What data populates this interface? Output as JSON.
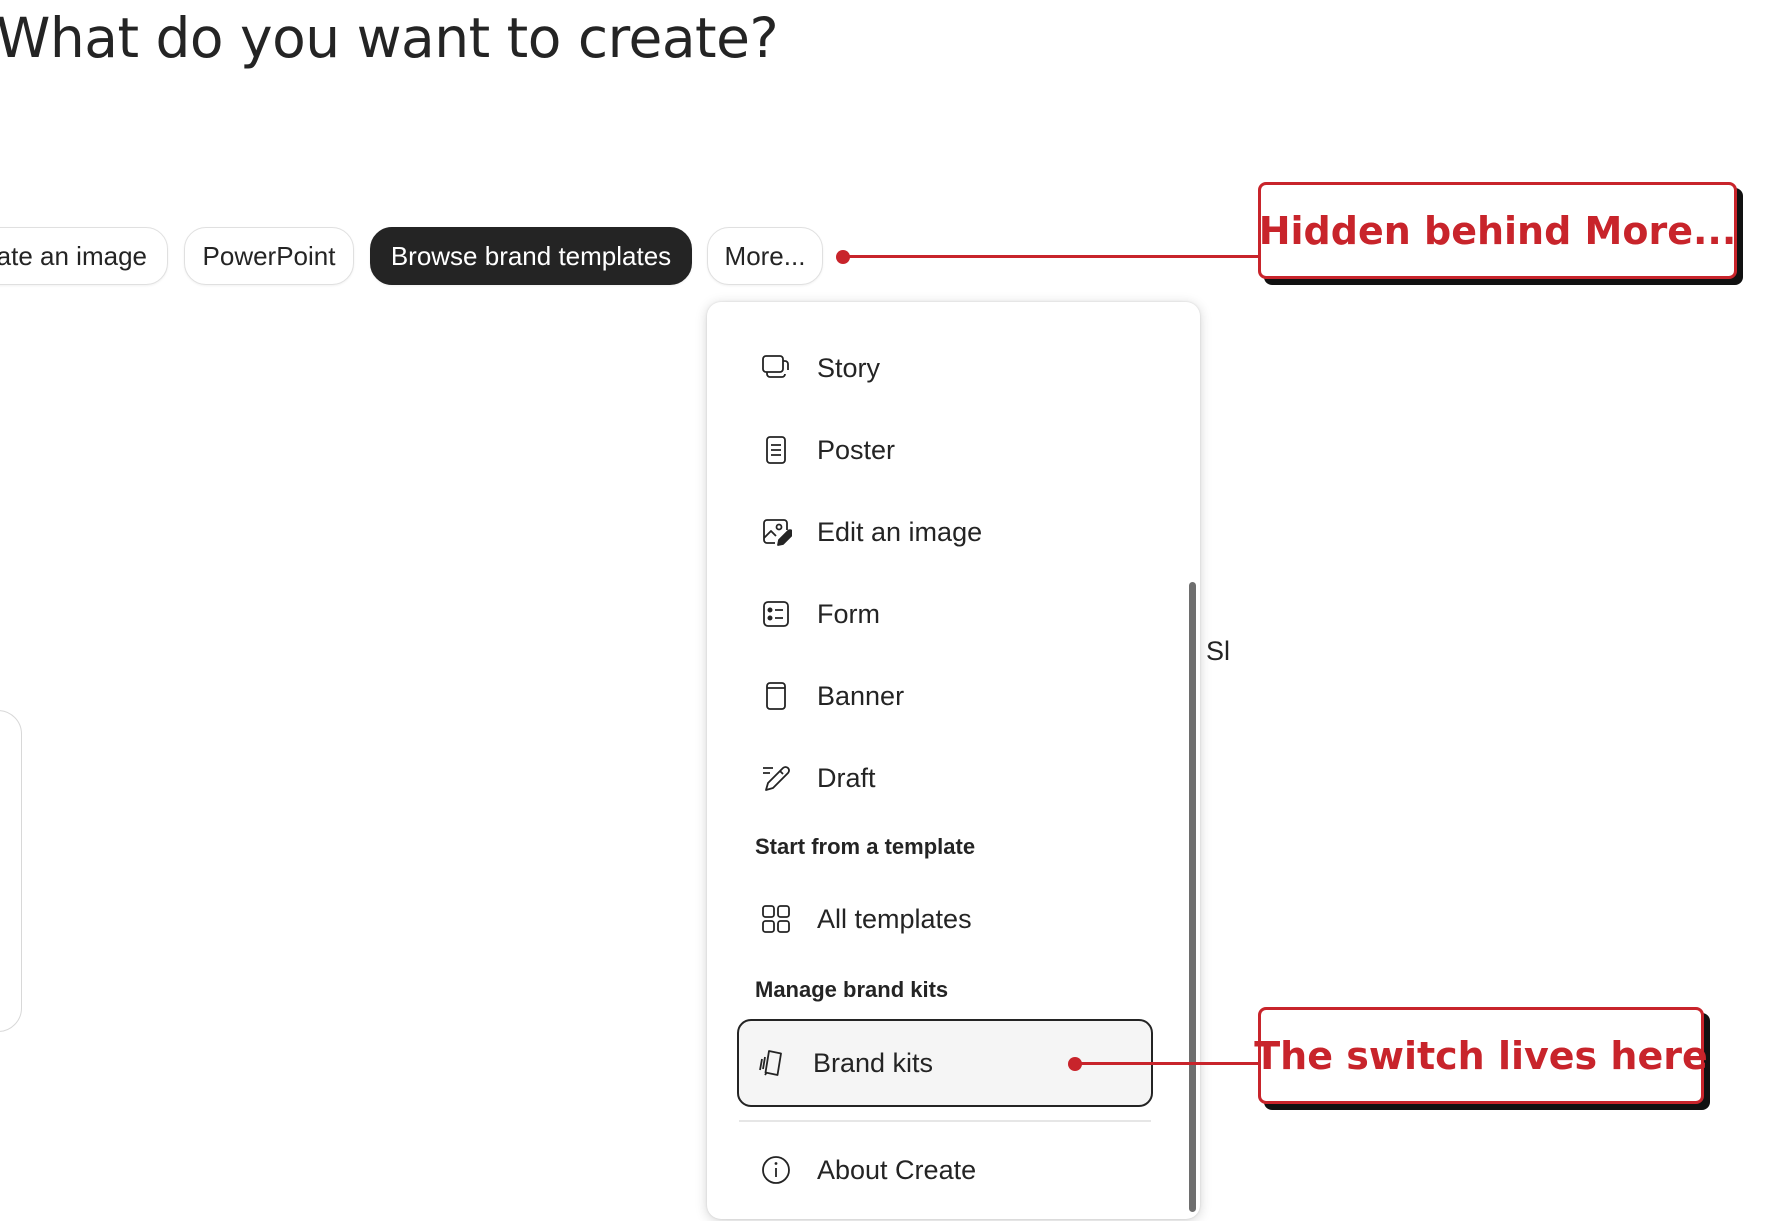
{
  "page": {
    "title": "What do you want to create?"
  },
  "pills": {
    "create_image": "ate an image",
    "powerpoint": "PowerPoint",
    "browse_brand_templates": "Browse brand templates",
    "more": "More..."
  },
  "menu": {
    "items": [
      {
        "label": "Story",
        "icon": "story-icon"
      },
      {
        "label": "Poster",
        "icon": "poster-icon"
      },
      {
        "label": "Edit an image",
        "icon": "edit-image-icon"
      },
      {
        "label": "Form",
        "icon": "form-icon"
      },
      {
        "label": "Banner",
        "icon": "banner-icon"
      },
      {
        "label": "Draft",
        "icon": "draft-icon"
      }
    ],
    "template_section": "Start from a template",
    "all_templates": "All templates",
    "brand_section": "Manage brand kits",
    "brand_kits": "Brand kits",
    "about": "About Create"
  },
  "background": {
    "partial_text": "Sl"
  },
  "annotations": {
    "more_callout": "Hidden behind More...",
    "switch_callout": "The switch lives here",
    "accent_color": "#c8242b"
  }
}
